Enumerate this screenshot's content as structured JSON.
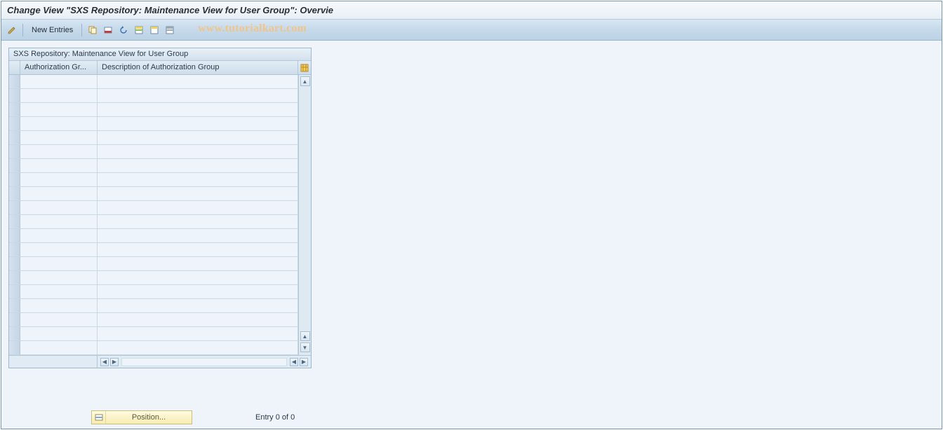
{
  "title": "Change View \"SXS Repository: Maintenance View for User Group\": Overvie",
  "toolbar": {
    "new_entries_label": "New Entries"
  },
  "watermark": "www.tutorialkart.com",
  "table": {
    "caption": "SXS Repository: Maintenance View for User Group",
    "columns": {
      "auth_group": "Authorization Gr...",
      "description": "Description of Authorization Group"
    },
    "row_count": 20
  },
  "footer": {
    "position_label": "Position...",
    "entry_text": "Entry 0 of 0"
  }
}
